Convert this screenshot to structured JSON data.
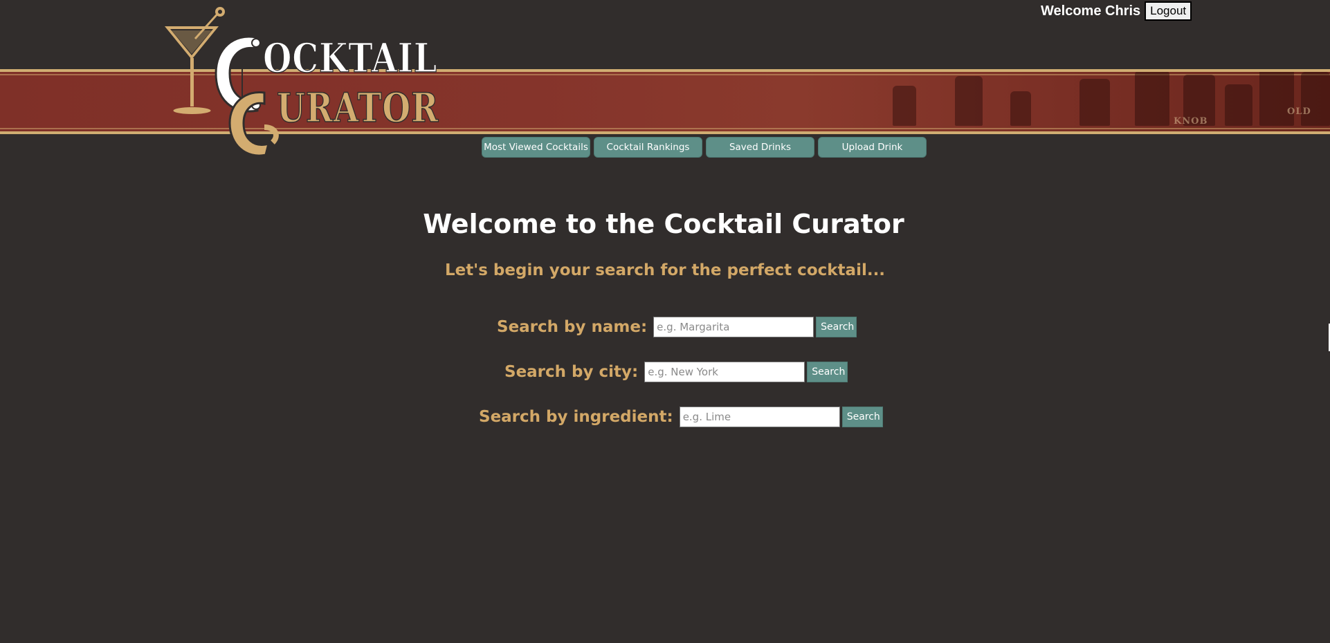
{
  "header": {
    "logo_text_line1": "Cocktail",
    "logo_text_line2": "Curator",
    "banner_bottle_labels": [
      "KNOB",
      "OLD"
    ],
    "welcome_text": "Welcome Chris",
    "logout_label": "Logout"
  },
  "nav": {
    "items": [
      {
        "label": "Most Viewed Cocktails"
      },
      {
        "label": "Cocktail Rankings"
      },
      {
        "label": "Saved Drinks"
      },
      {
        "label": "Upload Drink"
      }
    ]
  },
  "main": {
    "title": "Welcome to the Cocktail Curator",
    "subtitle": "Let's begin your search for the perfect cocktail...",
    "searches": [
      {
        "label": "Search by name:",
        "placeholder": "e.g. Margarita",
        "button": "Search"
      },
      {
        "label": "Search by city:",
        "placeholder": "e.g. New York",
        "button": "Search"
      },
      {
        "label": "Search by ingredient:",
        "placeholder": "e.g. Lime",
        "button": "Search"
      }
    ]
  },
  "colors": {
    "background": "#312d2c",
    "banner_red": "#85342b",
    "gold": "#d3a867",
    "teal_button": "#5e8f88"
  }
}
